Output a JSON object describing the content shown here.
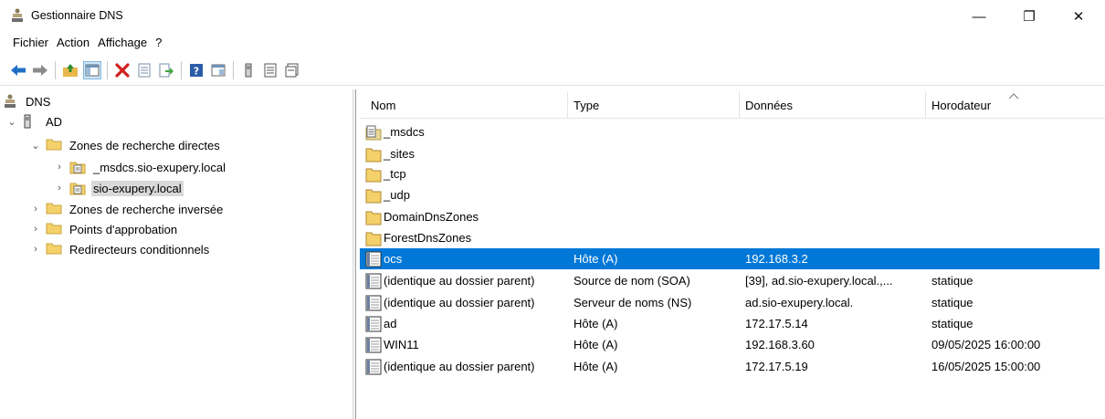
{
  "window": {
    "title": "Gestionnaire DNS",
    "minimize_glyph": "—",
    "maximize_glyph": "❐",
    "close_glyph": "✕"
  },
  "menu": [
    "Fichier",
    "Action",
    "Affichage",
    "?"
  ],
  "toolbar": {
    "icons": [
      "back-arrow-icon",
      "forward-arrow-icon",
      "up-folder-icon",
      "show-hide-tree-icon",
      "delete-icon",
      "properties-icon",
      "export-list-icon",
      "help-icon",
      "console-view-icon",
      "server-icon",
      "zone-icon",
      "record-icon"
    ]
  },
  "tree": {
    "root": "DNS",
    "server": "AD",
    "forward_zones": "Zones de recherche directes",
    "zone_msdcs": "_msdcs.sio-exupery.local",
    "zone_main": "sio-exupery.local",
    "reverse_zones": "Zones de recherche inversée",
    "trust_points": "Points d'approbation",
    "conditional_forwarders": "Redirecteurs conditionnels"
  },
  "list": {
    "columns": [
      "Nom",
      "Type",
      "Données",
      "Horodateur"
    ],
    "rows": [
      {
        "name": "_msdcs",
        "type": "",
        "data": "",
        "timestamp": "",
        "icon": "zone-folder-icon"
      },
      {
        "name": "_sites",
        "type": "",
        "data": "",
        "timestamp": "",
        "icon": "folder-icon"
      },
      {
        "name": "_tcp",
        "type": "",
        "data": "",
        "timestamp": "",
        "icon": "folder-icon"
      },
      {
        "name": "_udp",
        "type": "",
        "data": "",
        "timestamp": "",
        "icon": "folder-icon"
      },
      {
        "name": "DomainDnsZones",
        "type": "",
        "data": "",
        "timestamp": "",
        "icon": "folder-icon"
      },
      {
        "name": "ForestDnsZones",
        "type": "",
        "data": "",
        "timestamp": "",
        "icon": "folder-icon"
      },
      {
        "name": "ocs",
        "type": "Hôte (A)",
        "data": "192.168.3.2",
        "timestamp": "",
        "icon": "record-icon",
        "selected": true
      },
      {
        "name": "(identique au dossier parent)",
        "type": "Source de nom (SOA)",
        "data": "[39], ad.sio-exupery.local.,...",
        "timestamp": "statique",
        "icon": "record-icon"
      },
      {
        "name": "(identique au dossier parent)",
        "type": "Serveur de noms (NS)",
        "data": "ad.sio-exupery.local.",
        "timestamp": "statique",
        "icon": "record-icon"
      },
      {
        "name": "ad",
        "type": "Hôte (A)",
        "data": "172.17.5.14",
        "timestamp": "statique",
        "icon": "record-icon"
      },
      {
        "name": "WIN11",
        "type": "Hôte (A)",
        "data": "192.168.3.60",
        "timestamp": "09/05/2025 16:00:00",
        "icon": "record-icon"
      },
      {
        "name": "(identique au dossier parent)",
        "type": "Hôte (A)",
        "data": "172.17.5.19",
        "timestamp": "16/05/2025 15:00:00",
        "icon": "record-icon"
      }
    ]
  },
  "colors": {
    "selection": "#0078d7",
    "tree_selection": "#d9d9d9",
    "folder": "#f5d16b"
  }
}
